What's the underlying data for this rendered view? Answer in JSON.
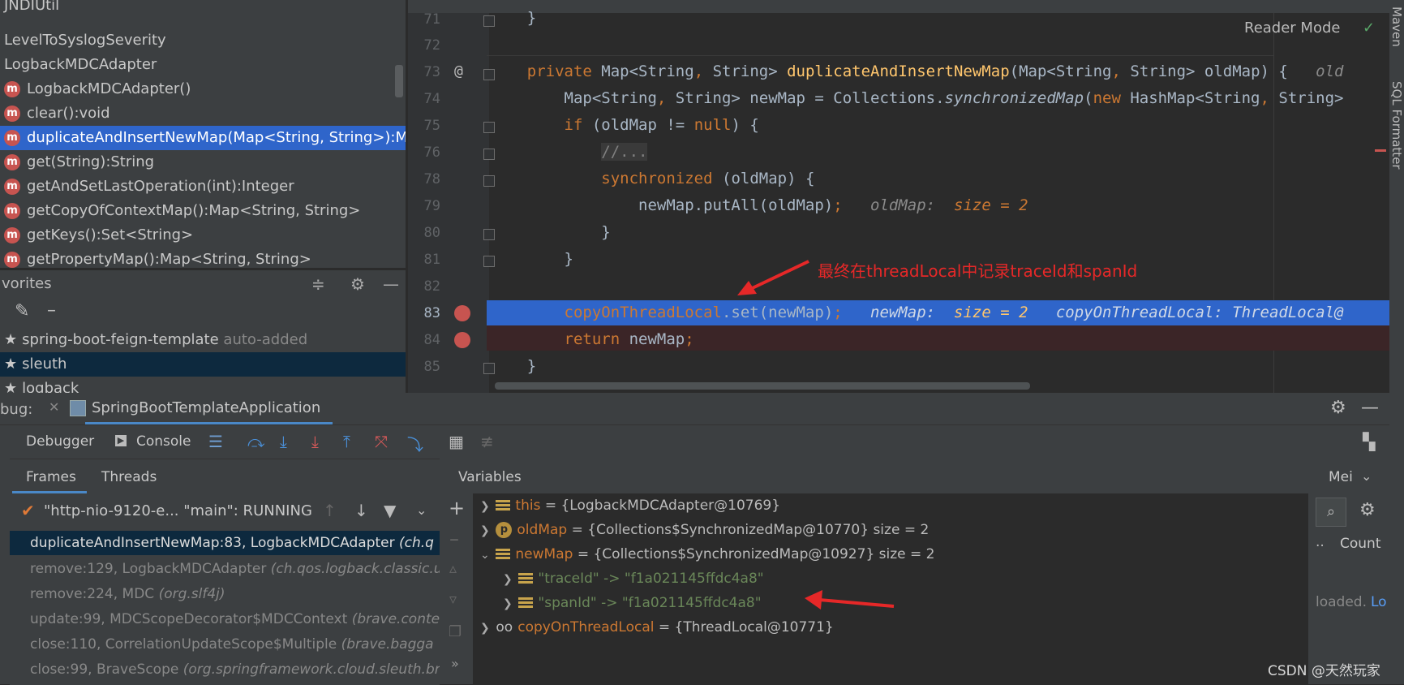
{
  "project": {
    "items": [
      {
        "label": "JNDIUtil",
        "type": "class"
      },
      {
        "label": "LevelToSyslogSeverity",
        "type": "class"
      },
      {
        "label": "LogbackMDCAdapter",
        "type": "class"
      },
      {
        "label": "LogbackMDCAdapter()",
        "type": "method"
      },
      {
        "label": "clear():void",
        "type": "method"
      },
      {
        "label": "duplicateAndInsertNewMap(Map<String, String>):Map",
        "type": "method",
        "selected": true
      },
      {
        "label": "get(String):String",
        "type": "method"
      },
      {
        "label": "getAndSetLastOperation(int):Integer",
        "type": "method"
      },
      {
        "label": "getCopyOfContextMap():Map<String, String>",
        "type": "method"
      },
      {
        "label": "getKeys():Set<String>",
        "type": "method"
      },
      {
        "label": "getPropertyMap():Map<String, String>",
        "type": "method"
      }
    ],
    "method_badge": "m"
  },
  "favorites": {
    "title": "vorites",
    "items": [
      {
        "label": "spring-boot-feign-template",
        "note": "auto-added"
      },
      {
        "label": "sleuth",
        "note": "",
        "selected": true
      },
      {
        "label": "logback",
        "note": ""
      }
    ]
  },
  "editor": {
    "reader_mode": "Reader Mode",
    "annotation": "最终在threadLocal中记录traceId和spanId",
    "lines": {
      "n71": "71",
      "n72": "72",
      "n73": "73",
      "n74": "74",
      "n75": "75",
      "n76": "76",
      "n78": "78",
      "n79": "79",
      "n80": "80",
      "n81": "81",
      "n82": "82",
      "n83": "83",
      "n84": "84",
      "n85": "85"
    },
    "hint_oldMap": "oldMap:",
    "hint_size": "size = 2",
    "hint_newMap": "newMap:",
    "hint_col": "copyOnThreadLocal:",
    "hint_tl": "ThreadLocal@"
  },
  "right_stripe": {
    "maven": "Maven",
    "sql": "SQL Formatter"
  },
  "debug": {
    "title": "bug:",
    "config": "SpringBootTemplateApplication",
    "tabs": {
      "debugger": "Debugger",
      "console": "Console"
    },
    "subtabs": {
      "frames": "Frames",
      "threads": "Threads",
      "variables": "Variables",
      "memory": "Mei"
    },
    "thread": "\"http-nio-9120-e... \"main\": RUNNING",
    "frames": [
      {
        "method": "duplicateAndInsertNewMap:83, LogbackMDCAdapter",
        "pkg": "(ch.q",
        "selected": true
      },
      {
        "method": "remove:129, LogbackMDCAdapter",
        "pkg": "(ch.qos.logback.classic.u"
      },
      {
        "method": "remove:224, MDC",
        "pkg": "(org.slf4j)"
      },
      {
        "method": "update:99, MDCScopeDecorator$MDCContext",
        "pkg": "(brave.conte"
      },
      {
        "method": "close:110, CorrelationUpdateScope$Multiple",
        "pkg": "(brave.bagga"
      },
      {
        "method": "close:99, BraveScope",
        "pkg": "(org.springframework.cloud.sleuth.bra"
      }
    ],
    "variables": [
      {
        "name": "this",
        "value": "= {LogbackMDCAdapter@10769}",
        "extra": ""
      },
      {
        "name": "oldMap",
        "value": "= {Collections$SynchronizedMap@10770}",
        "extra": "size = 2"
      },
      {
        "name": "newMap",
        "value": "= {Collections$SynchronizedMap@10927}",
        "extra": "size = 2"
      },
      {
        "name": "\"traceId\"",
        "value": "-> \"f1a021145ffdc4a8\"",
        "extra": ""
      },
      {
        "name": "\"spanId\"",
        "value": "-> \"f1a021145ffdc4a8\"",
        "extra": ""
      },
      {
        "name": "copyOnThreadLocal",
        "value": "= {ThreadLocal@10771}",
        "extra": ""
      }
    ],
    "memory": {
      "count": "Count",
      "dots": "..",
      "loaded": "loaded.",
      "lo": "Lo"
    }
  },
  "watermark": "CSDN @天然玩家"
}
